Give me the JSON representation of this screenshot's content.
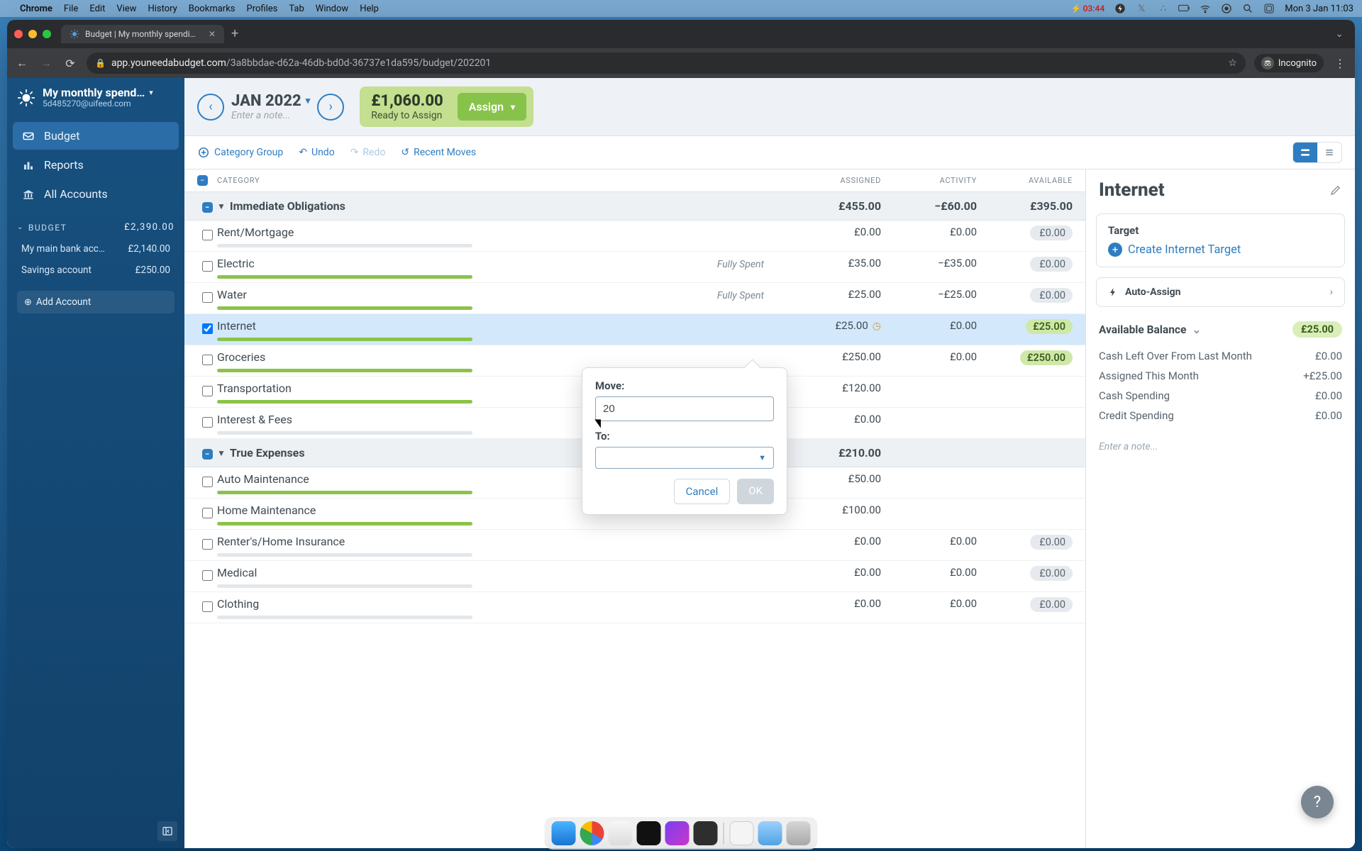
{
  "mac": {
    "app": "Chrome",
    "menus": [
      "File",
      "Edit",
      "View",
      "History",
      "Bookmarks",
      "Profiles",
      "Tab",
      "Window",
      "Help"
    ],
    "battery": "03:44",
    "clock": "Mon 3 Jan  11:03"
  },
  "chrome": {
    "tab_title": "Budget | My monthly spending",
    "url_domain": "app.youneedabudget.com",
    "url_path": "/3a8bbdae-d62a-46db-bd0d-36737e1da595/budget/202201",
    "incognito": "Incognito"
  },
  "sidebar": {
    "budget_name": "My monthly spend…",
    "email": "5d485270@uifeed.com",
    "nav": [
      {
        "label": "Budget"
      },
      {
        "label": "Reports"
      },
      {
        "label": "All Accounts"
      }
    ],
    "section": {
      "title": "BUDGET",
      "total": "£2,390.00"
    },
    "accounts": [
      {
        "name": "My main bank acc…",
        "balance": "£2,140.00"
      },
      {
        "name": "Savings account",
        "balance": "£250.00"
      }
    ],
    "add_account": "Add Account"
  },
  "header": {
    "month": "JAN 2022",
    "note_placeholder": "Enter a note...",
    "rta_amount": "£1,060.00",
    "rta_label": "Ready to Assign",
    "assign": "Assign"
  },
  "toolbar": {
    "category_group": "Category Group",
    "undo": "Undo",
    "redo": "Redo",
    "recent": "Recent Moves"
  },
  "columns": {
    "category": "CATEGORY",
    "assigned": "ASSIGNED",
    "activity": "ACTIVITY",
    "available": "AVAILABLE"
  },
  "groups": [
    {
      "name": "Immediate Obligations",
      "assigned": "£455.00",
      "activity": "−£60.00",
      "available": "£395.00",
      "rows": [
        {
          "name": "Rent/Mortgage",
          "status": "",
          "assigned": "£0.00",
          "activity": "£0.00",
          "available": "£0.00",
          "avail_style": "gray",
          "fill": 0
        },
        {
          "name": "Electric",
          "status": "Fully Spent",
          "assigned": "£35.00",
          "activity": "−£35.00",
          "available": "£0.00",
          "avail_style": "gray",
          "fill": 100
        },
        {
          "name": "Water",
          "status": "Fully Spent",
          "assigned": "£25.00",
          "activity": "−£25.00",
          "available": "£0.00",
          "avail_style": "gray",
          "fill": 100
        },
        {
          "name": "Internet",
          "status": "",
          "assigned": "£25.00",
          "activity": "£0.00",
          "available": "£25.00",
          "avail_style": "green",
          "fill": 100,
          "selected": true,
          "clock": true
        },
        {
          "name": "Groceries",
          "status": "",
          "assigned": "£250.00",
          "activity": "£0.00",
          "available": "£250.00",
          "avail_style": "green",
          "fill": 100
        },
        {
          "name": "Transportation",
          "status": "",
          "assigned": "£120.00",
          "activity": "",
          "available": "",
          "avail_style": "",
          "fill": 100
        },
        {
          "name": "Interest & Fees",
          "status": "",
          "assigned": "£0.00",
          "activity": "",
          "available": "",
          "avail_style": "",
          "fill": 0
        }
      ]
    },
    {
      "name": "True Expenses",
      "assigned": "£210.00",
      "activity": "",
      "available": "",
      "rows": [
        {
          "name": "Auto Maintenance",
          "status": "",
          "assigned": "£50.00",
          "activity": "",
          "available": "",
          "avail_style": "",
          "fill": 100
        },
        {
          "name": "Home Maintenance",
          "status": "",
          "assigned": "£100.00",
          "activity": "",
          "available": "",
          "avail_style": "",
          "fill": 100
        },
        {
          "name": "Renter's/Home Insurance",
          "status": "",
          "assigned": "£0.00",
          "activity": "£0.00",
          "available": "£0.00",
          "avail_style": "gray",
          "fill": 0
        },
        {
          "name": "Medical",
          "status": "",
          "assigned": "£0.00",
          "activity": "£0.00",
          "available": "£0.00",
          "avail_style": "gray",
          "fill": 0
        },
        {
          "name": "Clothing",
          "status": "",
          "assigned": "£0.00",
          "activity": "£0.00",
          "available": "£0.00",
          "avail_style": "gray",
          "fill": 0
        }
      ]
    }
  ],
  "inspector": {
    "title": "Internet",
    "target_label": "Target",
    "create_target": "Create Internet Target",
    "auto_assign": "Auto-Assign",
    "available_label": "Available Balance",
    "available_amount": "£25.00",
    "lines": [
      {
        "label": "Cash Left Over From Last Month",
        "value": "£0.00"
      },
      {
        "label": "Assigned This Month",
        "value": "+£25.00"
      },
      {
        "label": "Cash Spending",
        "value": "£0.00"
      },
      {
        "label": "Credit Spending",
        "value": "£0.00"
      }
    ],
    "note_placeholder": "Enter a note..."
  },
  "popover": {
    "move_label": "Move:",
    "move_value": "20",
    "to_label": "To:",
    "to_value": "",
    "cancel": "Cancel",
    "ok": "OK"
  }
}
